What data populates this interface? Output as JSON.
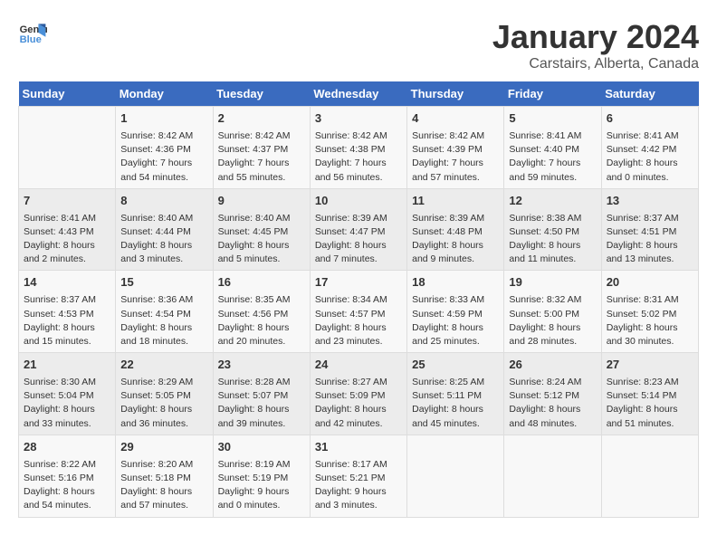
{
  "header": {
    "logo_general": "General",
    "logo_blue": "Blue",
    "title": "January 2024",
    "subtitle": "Carstairs, Alberta, Canada"
  },
  "days_of_week": [
    "Sunday",
    "Monday",
    "Tuesday",
    "Wednesday",
    "Thursday",
    "Friday",
    "Saturday"
  ],
  "weeks": [
    [
      {
        "day": "",
        "info": ""
      },
      {
        "day": "1",
        "info": "Sunrise: 8:42 AM\nSunset: 4:36 PM\nDaylight: 7 hours\nand 54 minutes."
      },
      {
        "day": "2",
        "info": "Sunrise: 8:42 AM\nSunset: 4:37 PM\nDaylight: 7 hours\nand 55 minutes."
      },
      {
        "day": "3",
        "info": "Sunrise: 8:42 AM\nSunset: 4:38 PM\nDaylight: 7 hours\nand 56 minutes."
      },
      {
        "day": "4",
        "info": "Sunrise: 8:42 AM\nSunset: 4:39 PM\nDaylight: 7 hours\nand 57 minutes."
      },
      {
        "day": "5",
        "info": "Sunrise: 8:41 AM\nSunset: 4:40 PM\nDaylight: 7 hours\nand 59 minutes."
      },
      {
        "day": "6",
        "info": "Sunrise: 8:41 AM\nSunset: 4:42 PM\nDaylight: 8 hours\nand 0 minutes."
      }
    ],
    [
      {
        "day": "7",
        "info": "Sunrise: 8:41 AM\nSunset: 4:43 PM\nDaylight: 8 hours\nand 2 minutes."
      },
      {
        "day": "8",
        "info": "Sunrise: 8:40 AM\nSunset: 4:44 PM\nDaylight: 8 hours\nand 3 minutes."
      },
      {
        "day": "9",
        "info": "Sunrise: 8:40 AM\nSunset: 4:45 PM\nDaylight: 8 hours\nand 5 minutes."
      },
      {
        "day": "10",
        "info": "Sunrise: 8:39 AM\nSunset: 4:47 PM\nDaylight: 8 hours\nand 7 minutes."
      },
      {
        "day": "11",
        "info": "Sunrise: 8:39 AM\nSunset: 4:48 PM\nDaylight: 8 hours\nand 9 minutes."
      },
      {
        "day": "12",
        "info": "Sunrise: 8:38 AM\nSunset: 4:50 PM\nDaylight: 8 hours\nand 11 minutes."
      },
      {
        "day": "13",
        "info": "Sunrise: 8:37 AM\nSunset: 4:51 PM\nDaylight: 8 hours\nand 13 minutes."
      }
    ],
    [
      {
        "day": "14",
        "info": "Sunrise: 8:37 AM\nSunset: 4:53 PM\nDaylight: 8 hours\nand 15 minutes."
      },
      {
        "day": "15",
        "info": "Sunrise: 8:36 AM\nSunset: 4:54 PM\nDaylight: 8 hours\nand 18 minutes."
      },
      {
        "day": "16",
        "info": "Sunrise: 8:35 AM\nSunset: 4:56 PM\nDaylight: 8 hours\nand 20 minutes."
      },
      {
        "day": "17",
        "info": "Sunrise: 8:34 AM\nSunset: 4:57 PM\nDaylight: 8 hours\nand 23 minutes."
      },
      {
        "day": "18",
        "info": "Sunrise: 8:33 AM\nSunset: 4:59 PM\nDaylight: 8 hours\nand 25 minutes."
      },
      {
        "day": "19",
        "info": "Sunrise: 8:32 AM\nSunset: 5:00 PM\nDaylight: 8 hours\nand 28 minutes."
      },
      {
        "day": "20",
        "info": "Sunrise: 8:31 AM\nSunset: 5:02 PM\nDaylight: 8 hours\nand 30 minutes."
      }
    ],
    [
      {
        "day": "21",
        "info": "Sunrise: 8:30 AM\nSunset: 5:04 PM\nDaylight: 8 hours\nand 33 minutes."
      },
      {
        "day": "22",
        "info": "Sunrise: 8:29 AM\nSunset: 5:05 PM\nDaylight: 8 hours\nand 36 minutes."
      },
      {
        "day": "23",
        "info": "Sunrise: 8:28 AM\nSunset: 5:07 PM\nDaylight: 8 hours\nand 39 minutes."
      },
      {
        "day": "24",
        "info": "Sunrise: 8:27 AM\nSunset: 5:09 PM\nDaylight: 8 hours\nand 42 minutes."
      },
      {
        "day": "25",
        "info": "Sunrise: 8:25 AM\nSunset: 5:11 PM\nDaylight: 8 hours\nand 45 minutes."
      },
      {
        "day": "26",
        "info": "Sunrise: 8:24 AM\nSunset: 5:12 PM\nDaylight: 8 hours\nand 48 minutes."
      },
      {
        "day": "27",
        "info": "Sunrise: 8:23 AM\nSunset: 5:14 PM\nDaylight: 8 hours\nand 51 minutes."
      }
    ],
    [
      {
        "day": "28",
        "info": "Sunrise: 8:22 AM\nSunset: 5:16 PM\nDaylight: 8 hours\nand 54 minutes."
      },
      {
        "day": "29",
        "info": "Sunrise: 8:20 AM\nSunset: 5:18 PM\nDaylight: 8 hours\nand 57 minutes."
      },
      {
        "day": "30",
        "info": "Sunrise: 8:19 AM\nSunset: 5:19 PM\nDaylight: 9 hours\nand 0 minutes."
      },
      {
        "day": "31",
        "info": "Sunrise: 8:17 AM\nSunset: 5:21 PM\nDaylight: 9 hours\nand 3 minutes."
      },
      {
        "day": "",
        "info": ""
      },
      {
        "day": "",
        "info": ""
      },
      {
        "day": "",
        "info": ""
      }
    ]
  ]
}
